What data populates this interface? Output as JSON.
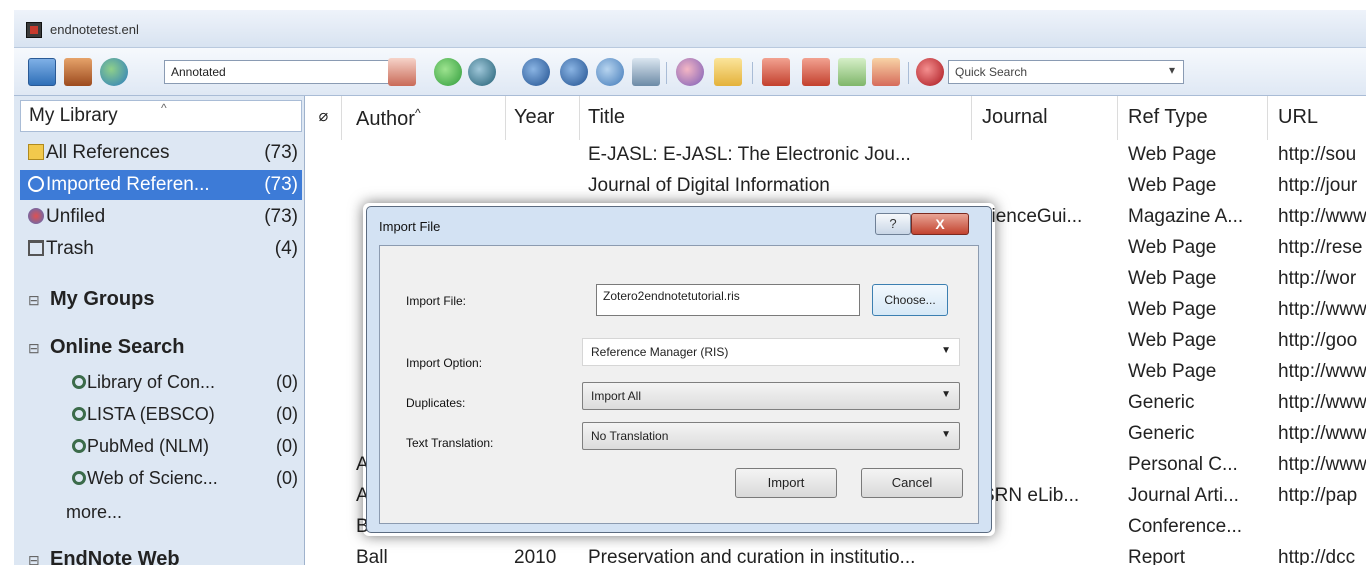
{
  "window": {
    "title": "endnotetest.enl"
  },
  "toolbar": {
    "style_value": "Annotated",
    "quick_search_placeholder": "Quick Search"
  },
  "library": {
    "header": "My Library",
    "items": [
      {
        "label": "All References",
        "count": "(73)"
      },
      {
        "label": "Imported Referen...",
        "count": "(73)"
      },
      {
        "label": "Unfiled",
        "count": "(73)"
      },
      {
        "label": "Trash",
        "count": "(4)"
      }
    ],
    "groups": {
      "my_groups": "My Groups",
      "online_search": "Online Search",
      "endnote_web": "EndNote Web"
    },
    "online": [
      {
        "label": "Library of Con...",
        "count": "(0)"
      },
      {
        "label": "LISTA (EBSCO)",
        "count": "(0)"
      },
      {
        "label": "PubMed (NLM)",
        "count": "(0)"
      },
      {
        "label": "Web of Scienc...",
        "count": "(0)"
      }
    ],
    "more": "more..."
  },
  "columns": {
    "author": "Author",
    "year": "Year",
    "title": "Title",
    "journal": "Journal",
    "ref_type": "Ref Type",
    "url": "URL"
  },
  "rows": [
    {
      "author": "",
      "year": "",
      "title": "E-JASL: E-JASL: The Electronic Jou...",
      "journal": "",
      "ref_type": "Web Page",
      "url": "http://sou"
    },
    {
      "author": "",
      "year": "",
      "title": "Journal of Digital Information",
      "journal": "",
      "ref_type": "Web Page",
      "url": "http://jour"
    },
    {
      "author": "",
      "year": "",
      "title": "",
      "journal": "cienceGui...",
      "ref_type": "Magazine A...",
      "url": "http://www"
    },
    {
      "author": "",
      "year": "",
      "title": "",
      "journal": "",
      "ref_type": "Web Page",
      "url": "http://rese"
    },
    {
      "author": "",
      "year": "",
      "title": "",
      "journal": "",
      "ref_type": "Web Page",
      "url": "http://wor"
    },
    {
      "author": "",
      "year": "",
      "title": "",
      "journal": "",
      "ref_type": "Web Page",
      "url": "http://www"
    },
    {
      "author": "",
      "year": "",
      "title": "",
      "journal": "",
      "ref_type": "Web Page",
      "url": "http://goo"
    },
    {
      "author": "",
      "year": "",
      "title": "",
      "journal": "",
      "ref_type": "Web Page",
      "url": "http://www"
    },
    {
      "author": "",
      "year": "",
      "title": "",
      "journal": "",
      "ref_type": "Generic",
      "url": "http://www"
    },
    {
      "author": "",
      "year": "",
      "title": "",
      "journal": "",
      "ref_type": "Generic",
      "url": "http://www"
    },
    {
      "author": "A",
      "year": "",
      "title": "",
      "journal": "",
      "ref_type": "Personal C...",
      "url": "http://www"
    },
    {
      "author": "A",
      "year": "",
      "title": "",
      "journal": "SRN eLib...",
      "ref_type": "Journal Arti...",
      "url": "http://pap"
    },
    {
      "author": "B",
      "year": "",
      "title": "",
      "journal": "",
      "ref_type": "Conference...",
      "url": ""
    },
    {
      "author": "Ball",
      "year": "2010",
      "title": "Preservation and curation in institutio...",
      "journal": "",
      "ref_type": "Report",
      "url": "http://dcc"
    }
  ],
  "dialog": {
    "title": "Import File",
    "help": "?",
    "close": "X",
    "import_file_label": "Import File:",
    "import_file_value": "Zotero2endnotetutorial.ris",
    "choose": "Choose...",
    "import_option_label": "Import Option:",
    "import_option_value": "Reference Manager (RIS)",
    "duplicates_label": "Duplicates:",
    "duplicates_value": "Import All",
    "translation_label": "Text Translation:",
    "translation_value": "No Translation",
    "import_button": "Import",
    "cancel_button": "Cancel"
  }
}
